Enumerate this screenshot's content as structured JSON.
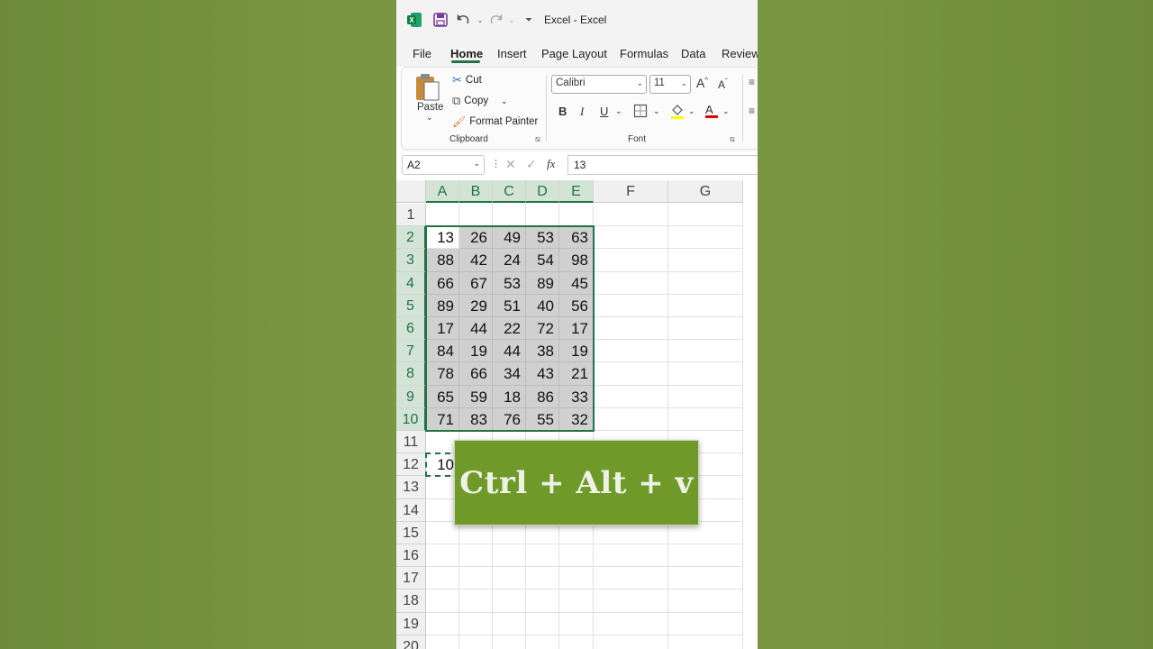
{
  "titlebar": {
    "title": "Excel  -  Excel"
  },
  "menu": {
    "tabs": [
      {
        "label": "File"
      },
      {
        "label": "Home"
      },
      {
        "label": "Insert"
      },
      {
        "label": "Page Layout"
      },
      {
        "label": "Formulas"
      },
      {
        "label": "Data"
      },
      {
        "label": "Review"
      }
    ],
    "active": "Home"
  },
  "ribbon": {
    "clipboard": {
      "paste_label": "Paste",
      "cut_label": "Cut",
      "copy_label": "Copy",
      "format_painter_label": "Format Painter",
      "group_label": "Clipboard"
    },
    "font": {
      "font_name": "Calibri",
      "font_size": "11",
      "grow_label": "A",
      "shrink_label": "A",
      "bold_label": "B",
      "italic_label": "I",
      "underline_label": "U",
      "font_color_label": "A",
      "group_label": "Font",
      "font_color": "#e00000"
    }
  },
  "formula_bar": {
    "name_box": "A2",
    "fx_label": "fx",
    "value": "13"
  },
  "grid": {
    "columns": [
      "A",
      "B",
      "C",
      "D",
      "E",
      "F",
      "G"
    ],
    "rows": [
      "1",
      "2",
      "3",
      "4",
      "5",
      "6",
      "7",
      "8",
      "9",
      "10",
      "11",
      "12",
      "13",
      "14",
      "15",
      "16",
      "17",
      "18",
      "19",
      "20"
    ],
    "values": [
      [
        "13",
        "26",
        "49",
        "53",
        "63"
      ],
      [
        "88",
        "42",
        "24",
        "54",
        "98"
      ],
      [
        "66",
        "67",
        "53",
        "89",
        "45"
      ],
      [
        "89",
        "29",
        "51",
        "40",
        "56"
      ],
      [
        "17",
        "44",
        "22",
        "72",
        "17"
      ],
      [
        "84",
        "19",
        "44",
        "38",
        "19"
      ],
      [
        "78",
        "66",
        "34",
        "43",
        "21"
      ],
      [
        "65",
        "59",
        "18",
        "86",
        "33"
      ],
      [
        "71",
        "83",
        "76",
        "55",
        "32"
      ]
    ],
    "a12_value": "10"
  },
  "overlay": {
    "shortcut": "Ctrl + Alt + v"
  },
  "colors": {
    "accent": "#217346",
    "selection": "#d0d0d0",
    "overlay": "#6f9a2a"
  }
}
